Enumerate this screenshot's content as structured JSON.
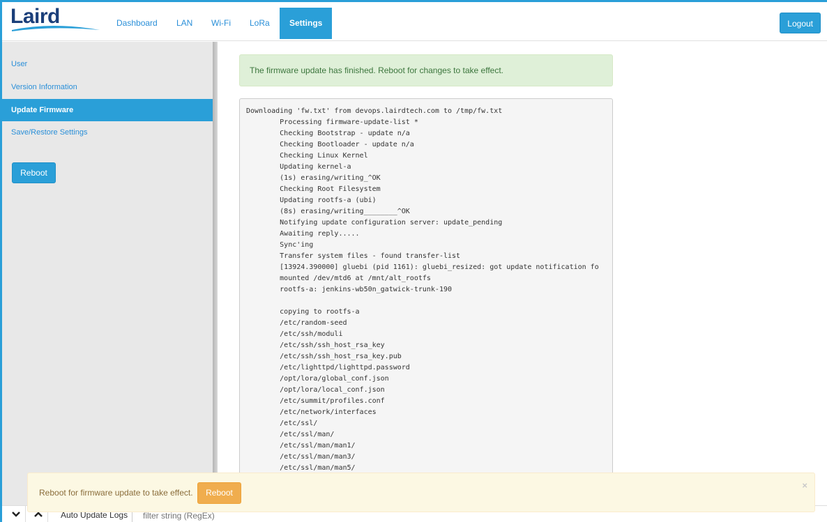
{
  "nav": {
    "items": [
      {
        "label": "Dashboard"
      },
      {
        "label": "LAN"
      },
      {
        "label": "Wi-Fi"
      },
      {
        "label": "LoRa"
      },
      {
        "label": "Settings"
      }
    ],
    "logout_label": "Logout",
    "logo_text": "Laird",
    "accent_color": "#2a9fd8"
  },
  "sidebar": {
    "items": [
      {
        "label": "User"
      },
      {
        "label": "Version Information"
      },
      {
        "label": "Update Firmware"
      },
      {
        "label": "Save/Restore Settings"
      }
    ],
    "reboot_label": "Reboot"
  },
  "main": {
    "success_message": "The firmware update has finished. Reboot for changes to take effect.",
    "log_text": "Downloading 'fw.txt' from devops.lairdtech.com to /tmp/fw.txt\n        Processing firmware-update-list *\n        Checking Bootstrap - update n/a\n        Checking Bootloader - update n/a\n        Checking Linux Kernel\n        Updating kernel-a\n        (1s) erasing/writing_^OK\n        Checking Root Filesystem\n        Updating rootfs-a (ubi)\n        (8s) erasing/writing________^OK\n        Notifying update configuration server: update_pending\n        Awaiting reply.....\n        Sync'ing\n        Transfer system files - found transfer-list\n        [13924.390000] gluebi (pid 1161): gluebi_resized: got update notification fo\n        mounted /dev/mtd6 at /mnt/alt_rootfs\n        rootfs-a: jenkins-wb50n_gatwick-trunk-190\n\n        copying to rootfs-a\n        /etc/random-seed\n        /etc/ssh/moduli\n        /etc/ssh/ssh_host_rsa_key\n        /etc/ssh/ssh_host_rsa_key.pub\n        /etc/lighttpd/lighttpd.password\n        /opt/lora/global_conf.json\n        /opt/lora/local_conf.json\n        /etc/summit/profiles.conf\n        /etc/network/interfaces\n        /etc/ssl/\n        /etc/ssl/man/\n        /etc/ssl/man/man1/\n        /etc/ssl/man/man3/\n        /etc/ssl/man/man5/"
  },
  "bottom_bar": {
    "auto_update_label": "Auto Update Logs",
    "filter_placeholder": "filter string (RegEx)"
  },
  "toast": {
    "message": "Reboot for firmware update to take effect.",
    "reboot_label": "Reboot",
    "close_glyph": "×"
  }
}
